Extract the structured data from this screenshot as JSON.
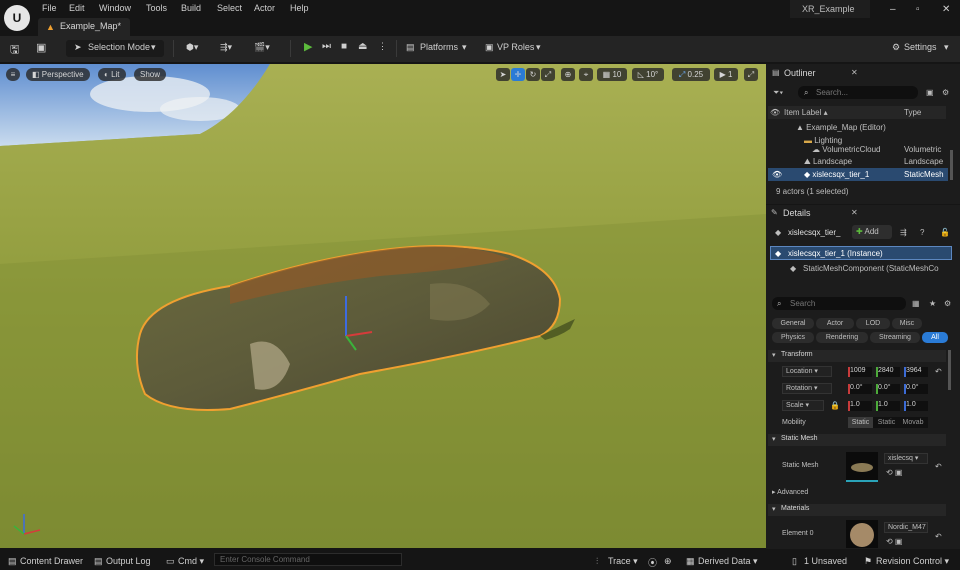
{
  "menu": [
    "File",
    "Edit",
    "Window",
    "Tools",
    "Build",
    "Select",
    "Actor",
    "Help"
  ],
  "map_tab": "Example_Map*",
  "project": "XR_Example",
  "toolbar": {
    "selection_mode": "Selection Mode",
    "platforms": "Platforms",
    "vp_roles": "VP Roles",
    "settings": "Settings"
  },
  "viewport": {
    "perspective": "Perspective",
    "lit": "Lit",
    "show": "Show",
    "grid": "10",
    "angle": "10°",
    "scale": "0.25",
    "cam": "1"
  },
  "outliner": {
    "title": "Outliner",
    "search": "Search...",
    "col_label": "Item Label ▴",
    "col_type": "Type",
    "rows": [
      {
        "label": "Example_Map (Editor)",
        "type": ""
      },
      {
        "label": "Lighting",
        "type": ""
      },
      {
        "label": "VolumetricCloud",
        "type": "Volumetric"
      },
      {
        "label": "Landscape",
        "type": "Landscape"
      },
      {
        "label": "xislecsqx_tier_1",
        "type": "StaticMesh"
      }
    ],
    "count": "9 actors (1 selected)"
  },
  "details": {
    "title": "Details",
    "actor": "xislecsqx_tier_",
    "add": "Add",
    "instance": "xislecsqx_tier_1 (Instance)",
    "component": "StaticMeshComponent (StaticMeshCo",
    "search": "Search",
    "cats": [
      "General",
      "Actor",
      "LOD",
      "Misc",
      "Physics",
      "Rendering",
      "Streaming",
      "All"
    ],
    "transform": "Transform",
    "location": "Location",
    "rotation": "Rotation",
    "scale": "Scale",
    "loc": [
      "1009",
      "2840",
      "3964"
    ],
    "rot": [
      "0.0°",
      "0.0°",
      "0.0°"
    ],
    "scl": [
      "1.0",
      "1.0",
      "1.0"
    ],
    "mobility": "Mobility",
    "mob_opts": [
      "Static",
      "Static",
      "Movab"
    ],
    "static_mesh_sec": "Static Mesh",
    "static_mesh": "Static Mesh",
    "mesh_name": "xislecsq",
    "advanced": "Advanced",
    "materials": "Materials",
    "element0": "Element 0",
    "mat_name": "Nordic_M47"
  },
  "status": {
    "content_drawer": "Content Drawer",
    "output_log": "Output Log",
    "cmd": "Cmd",
    "console": "Enter Console Command",
    "trace": "Trace",
    "derived": "Derived Data",
    "unsaved": "1 Unsaved",
    "revision": "Revision Control"
  },
  "colors": {
    "accent": "#2a7bd6",
    "selection": "#f0a030",
    "play": "#5cbb3c"
  }
}
